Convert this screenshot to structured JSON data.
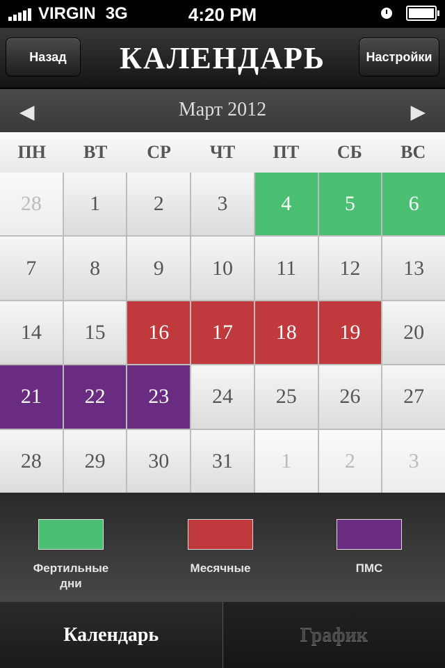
{
  "status": {
    "carrier": "VIRGIN",
    "network": "3G",
    "time": "4:20 PM"
  },
  "nav": {
    "back_label": "Назад",
    "title": "КАЛЕНДАРЬ",
    "settings_label": "Настройки"
  },
  "month": {
    "title": "Март 2012",
    "prev_icon": "left-arrow-icon",
    "next_icon": "right-arrow-icon"
  },
  "weekdays": [
    "ПН",
    "ВТ",
    "СР",
    "ЧТ",
    "ПТ",
    "СБ",
    "ВС"
  ],
  "days": [
    {
      "num": "28",
      "type": "other"
    },
    {
      "num": "1",
      "type": "normal"
    },
    {
      "num": "2",
      "type": "normal"
    },
    {
      "num": "3",
      "type": "normal"
    },
    {
      "num": "4",
      "type": "fertile"
    },
    {
      "num": "5",
      "type": "fertile"
    },
    {
      "num": "6",
      "type": "fertile"
    },
    {
      "num": "7",
      "type": "normal"
    },
    {
      "num": "8",
      "type": "normal"
    },
    {
      "num": "9",
      "type": "normal"
    },
    {
      "num": "10",
      "type": "normal"
    },
    {
      "num": "11",
      "type": "normal"
    },
    {
      "num": "12",
      "type": "normal"
    },
    {
      "num": "13",
      "type": "normal"
    },
    {
      "num": "14",
      "type": "normal"
    },
    {
      "num": "15",
      "type": "normal"
    },
    {
      "num": "16",
      "type": "period"
    },
    {
      "num": "17",
      "type": "period"
    },
    {
      "num": "18",
      "type": "period"
    },
    {
      "num": "19",
      "type": "period"
    },
    {
      "num": "20",
      "type": "normal"
    },
    {
      "num": "21",
      "type": "pms"
    },
    {
      "num": "22",
      "type": "pms"
    },
    {
      "num": "23",
      "type": "pms"
    },
    {
      "num": "24",
      "type": "normal"
    },
    {
      "num": "25",
      "type": "normal"
    },
    {
      "num": "26",
      "type": "normal"
    },
    {
      "num": "27",
      "type": "normal"
    },
    {
      "num": "28",
      "type": "normal"
    },
    {
      "num": "29",
      "type": "normal"
    },
    {
      "num": "30",
      "type": "normal"
    },
    {
      "num": "31",
      "type": "normal"
    },
    {
      "num": "1",
      "type": "other"
    },
    {
      "num": "2",
      "type": "other"
    },
    {
      "num": "3",
      "type": "other"
    }
  ],
  "legend": {
    "fertile": {
      "label": "Фертильные дни",
      "color": "#4bbf72"
    },
    "period": {
      "label": "Месячные",
      "color": "#c0393c"
    },
    "pms": {
      "label": "ПМС",
      "color": "#6a2c80"
    }
  },
  "tabs": {
    "calendar": "Календарь",
    "chart": "График"
  }
}
